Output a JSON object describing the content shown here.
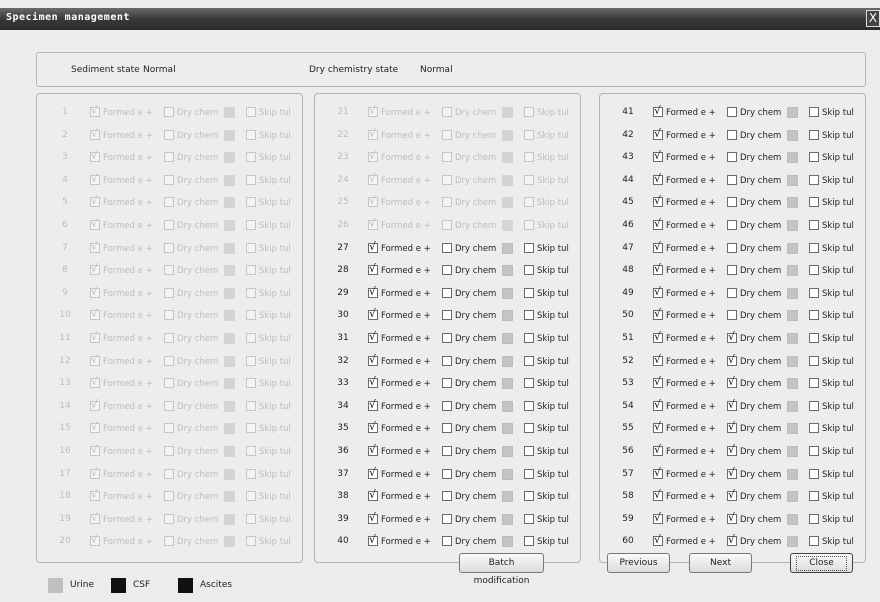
{
  "window": {
    "title": "Specimen management",
    "close_glyph": "X"
  },
  "state": {
    "sediment_label": "Sediment state",
    "sediment_value": "Normal",
    "dry_label": "Dry chemistry state",
    "dry_value": "Normal"
  },
  "options": {
    "formed": "Formed e +",
    "dry": "Dry chem",
    "skip": "Skip tul"
  },
  "groups": [
    {
      "rows": [
        {
          "num": "1",
          "enabled": false,
          "formed": true,
          "dry": false,
          "skip": false
        },
        {
          "num": "2",
          "enabled": false,
          "formed": true,
          "dry": false,
          "skip": false
        },
        {
          "num": "3",
          "enabled": false,
          "formed": true,
          "dry": false,
          "skip": false
        },
        {
          "num": "4",
          "enabled": false,
          "formed": true,
          "dry": false,
          "skip": false
        },
        {
          "num": "5",
          "enabled": false,
          "formed": true,
          "dry": false,
          "skip": false
        },
        {
          "num": "6",
          "enabled": false,
          "formed": true,
          "dry": false,
          "skip": false
        },
        {
          "num": "7",
          "enabled": false,
          "formed": true,
          "dry": false,
          "skip": false
        },
        {
          "num": "8",
          "enabled": false,
          "formed": true,
          "dry": false,
          "skip": false
        },
        {
          "num": "9",
          "enabled": false,
          "formed": true,
          "dry": false,
          "skip": false
        },
        {
          "num": "10",
          "enabled": false,
          "formed": true,
          "dry": false,
          "skip": false
        },
        {
          "num": "11",
          "enabled": false,
          "formed": true,
          "dry": false,
          "skip": false
        },
        {
          "num": "12",
          "enabled": false,
          "formed": true,
          "dry": false,
          "skip": false
        },
        {
          "num": "13",
          "enabled": false,
          "formed": true,
          "dry": false,
          "skip": false
        },
        {
          "num": "14",
          "enabled": false,
          "formed": true,
          "dry": false,
          "skip": false
        },
        {
          "num": "15",
          "enabled": false,
          "formed": true,
          "dry": false,
          "skip": false
        },
        {
          "num": "16",
          "enabled": false,
          "formed": true,
          "dry": false,
          "skip": false
        },
        {
          "num": "17",
          "enabled": false,
          "formed": true,
          "dry": false,
          "skip": false
        },
        {
          "num": "18",
          "enabled": false,
          "formed": true,
          "dry": false,
          "skip": false
        },
        {
          "num": "19",
          "enabled": false,
          "formed": true,
          "dry": false,
          "skip": false
        },
        {
          "num": "20",
          "enabled": false,
          "formed": true,
          "dry": false,
          "skip": false
        }
      ]
    },
    {
      "rows": [
        {
          "num": "21",
          "enabled": false,
          "formed": true,
          "dry": false,
          "skip": false
        },
        {
          "num": "22",
          "enabled": false,
          "formed": true,
          "dry": false,
          "skip": false
        },
        {
          "num": "23",
          "enabled": false,
          "formed": true,
          "dry": false,
          "skip": false
        },
        {
          "num": "24",
          "enabled": false,
          "formed": true,
          "dry": false,
          "skip": false
        },
        {
          "num": "25",
          "enabled": false,
          "formed": true,
          "dry": false,
          "skip": false
        },
        {
          "num": "26",
          "enabled": false,
          "formed": true,
          "dry": false,
          "skip": false
        },
        {
          "num": "27",
          "enabled": true,
          "formed": true,
          "dry": false,
          "skip": false
        },
        {
          "num": "28",
          "enabled": true,
          "formed": true,
          "dry": false,
          "skip": false
        },
        {
          "num": "29",
          "enabled": true,
          "formed": true,
          "dry": false,
          "skip": false
        },
        {
          "num": "30",
          "enabled": true,
          "formed": true,
          "dry": false,
          "skip": false
        },
        {
          "num": "31",
          "enabled": true,
          "formed": true,
          "dry": false,
          "skip": false
        },
        {
          "num": "32",
          "enabled": true,
          "formed": true,
          "dry": false,
          "skip": false
        },
        {
          "num": "33",
          "enabled": true,
          "formed": true,
          "dry": false,
          "skip": false
        },
        {
          "num": "34",
          "enabled": true,
          "formed": true,
          "dry": false,
          "skip": false
        },
        {
          "num": "35",
          "enabled": true,
          "formed": true,
          "dry": false,
          "skip": false
        },
        {
          "num": "36",
          "enabled": true,
          "formed": true,
          "dry": false,
          "skip": false
        },
        {
          "num": "37",
          "enabled": true,
          "formed": true,
          "dry": false,
          "skip": false
        },
        {
          "num": "38",
          "enabled": true,
          "formed": true,
          "dry": false,
          "skip": false
        },
        {
          "num": "39",
          "enabled": true,
          "formed": true,
          "dry": false,
          "skip": false
        },
        {
          "num": "40",
          "enabled": true,
          "formed": true,
          "dry": false,
          "skip": false
        }
      ]
    },
    {
      "rows": [
        {
          "num": "41",
          "enabled": true,
          "formed": true,
          "dry": false,
          "skip": false
        },
        {
          "num": "42",
          "enabled": true,
          "formed": true,
          "dry": false,
          "skip": false
        },
        {
          "num": "43",
          "enabled": true,
          "formed": true,
          "dry": false,
          "skip": false
        },
        {
          "num": "44",
          "enabled": true,
          "formed": true,
          "dry": false,
          "skip": false
        },
        {
          "num": "45",
          "enabled": true,
          "formed": true,
          "dry": false,
          "skip": false
        },
        {
          "num": "46",
          "enabled": true,
          "formed": true,
          "dry": false,
          "skip": false
        },
        {
          "num": "47",
          "enabled": true,
          "formed": true,
          "dry": false,
          "skip": false
        },
        {
          "num": "48",
          "enabled": true,
          "formed": true,
          "dry": false,
          "skip": false
        },
        {
          "num": "49",
          "enabled": true,
          "formed": true,
          "dry": false,
          "skip": false
        },
        {
          "num": "50",
          "enabled": true,
          "formed": true,
          "dry": false,
          "skip": false
        },
        {
          "num": "51",
          "enabled": true,
          "formed": true,
          "dry": true,
          "skip": false
        },
        {
          "num": "52",
          "enabled": true,
          "formed": true,
          "dry": true,
          "skip": false
        },
        {
          "num": "53",
          "enabled": true,
          "formed": true,
          "dry": true,
          "skip": false
        },
        {
          "num": "54",
          "enabled": true,
          "formed": true,
          "dry": true,
          "skip": false
        },
        {
          "num": "55",
          "enabled": true,
          "formed": true,
          "dry": true,
          "skip": false
        },
        {
          "num": "56",
          "enabled": true,
          "formed": true,
          "dry": true,
          "skip": false
        },
        {
          "num": "57",
          "enabled": true,
          "formed": true,
          "dry": true,
          "skip": false
        },
        {
          "num": "58",
          "enabled": true,
          "formed": true,
          "dry": true,
          "skip": false
        },
        {
          "num": "59",
          "enabled": true,
          "formed": true,
          "dry": true,
          "skip": false
        },
        {
          "num": "60",
          "enabled": true,
          "formed": true,
          "dry": true,
          "skip": false
        }
      ]
    }
  ],
  "legend": [
    {
      "label": "Urine",
      "color": "#c0c0c0"
    },
    {
      "label": "CSF",
      "color": "#111111"
    },
    {
      "label": "Ascites",
      "color": "#111111"
    }
  ],
  "buttons": {
    "batch": "Batch modification",
    "previous": "Previous",
    "next": "Next",
    "close": "Close"
  },
  "colors": {
    "title_bar": "#2f2f2f",
    "background": "#ececec",
    "disabled_text": "#bdbdbd"
  }
}
